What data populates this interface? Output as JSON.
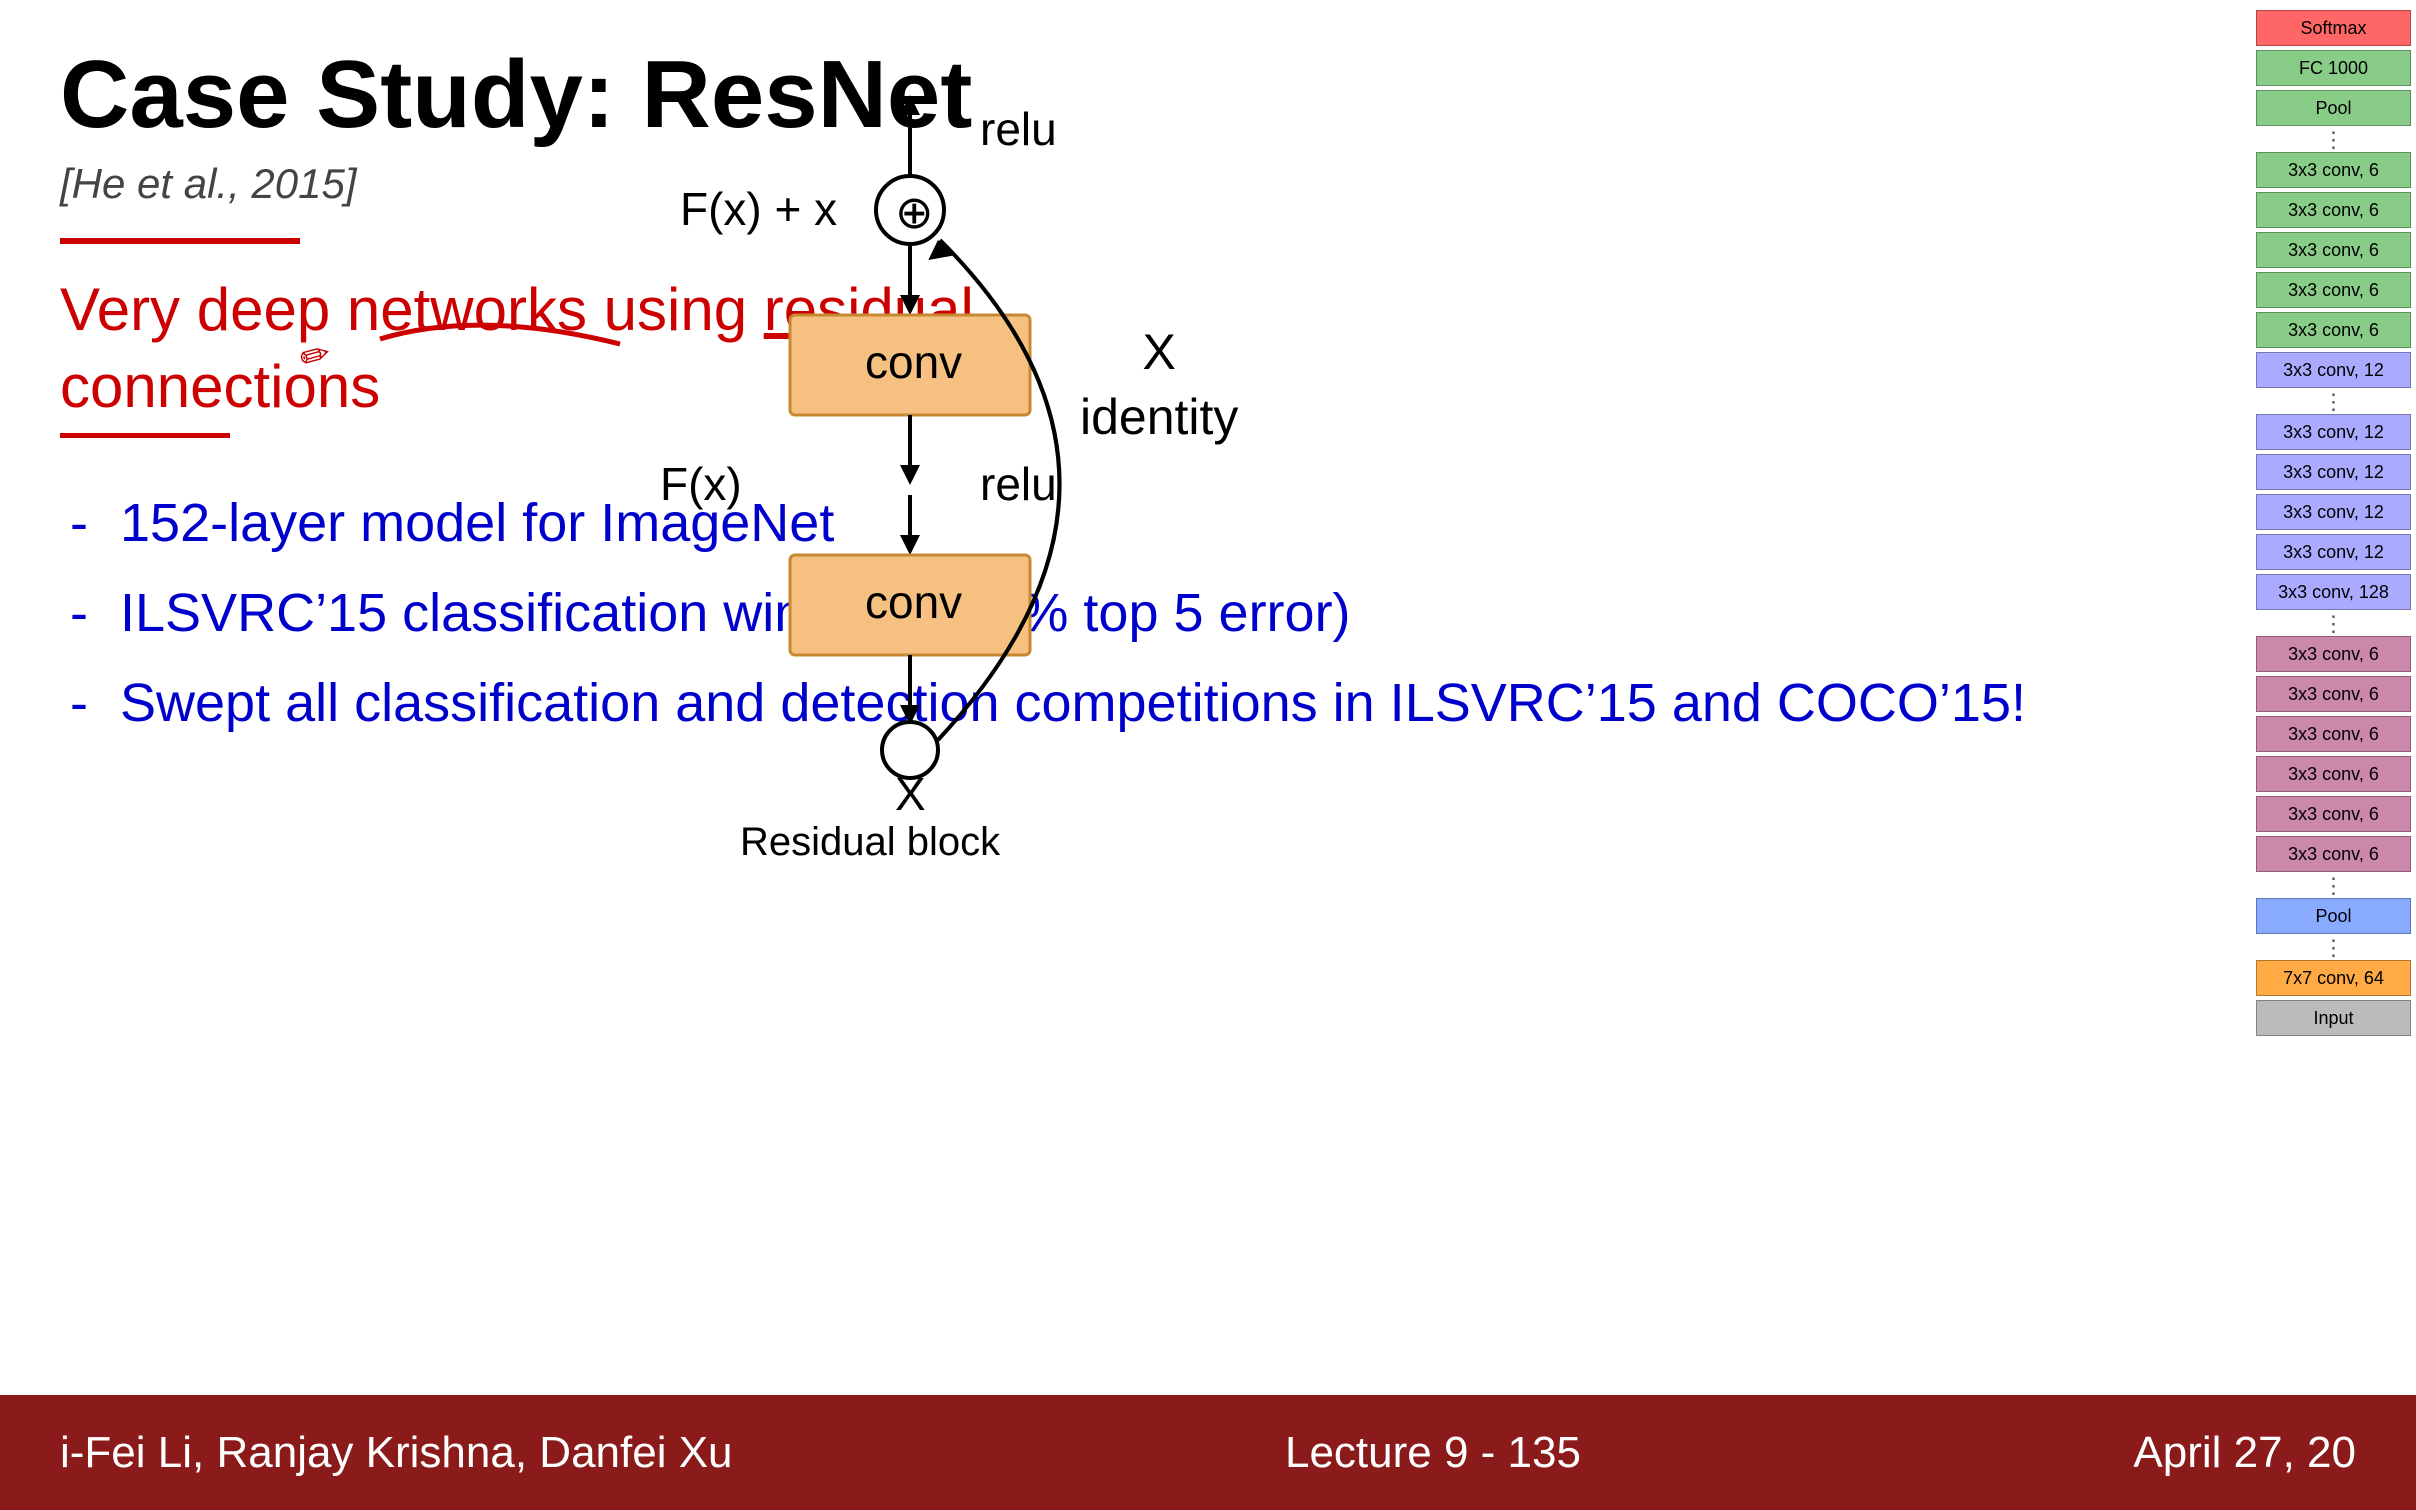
{
  "slide": {
    "title": "Case Study: ResNet",
    "subtitle": "[He et al., 2015]",
    "description_line1": "Very deep networks using residual",
    "description_line2": "connections",
    "bullet1": "152-layer model for ImageNet",
    "bullet2": "ILSVRC’15 classification winner (3.57% top 5 error)",
    "bullet3": "Swept all classification and detection competitions in ILSVRC’15 and COCO’15!",
    "diagram": {
      "relu_top": "relu",
      "fx_plus_x": "F(x) + x",
      "conv_top": "conv",
      "relu_mid": "relu",
      "conv_bottom": "conv",
      "fx_label": "F(x)",
      "x_label": "X",
      "residual_block_label": "Residual block",
      "x_identity": "X",
      "identity": "identity"
    },
    "sidebar_layers": [
      {
        "label": "Softmax",
        "color": "#ff6666"
      },
      {
        "label": "FC 1000",
        "color": "#88cc88"
      },
      {
        "label": "Pool",
        "color": "#88cc88"
      },
      {
        "label": "3x3 conv, 6",
        "color": "#88cc88"
      },
      {
        "label": "3x3 conv, 6",
        "color": "#88cc88"
      },
      {
        "label": "3x3 conv, 6",
        "color": "#88cc88"
      },
      {
        "label": "3x3 conv, 6",
        "color": "#88cc88"
      },
      {
        "label": "3x3 conv, 6",
        "color": "#88cc88"
      },
      {
        "label": "3x3 conv, 12",
        "color": "#aaaaff"
      },
      {
        "label": "3x3 conv, 12",
        "color": "#aaaaff"
      },
      {
        "label": "3x3 conv, 12",
        "color": "#aaaaff"
      },
      {
        "label": "3x3 conv, 12",
        "color": "#aaaaff"
      },
      {
        "label": "3x3 conv, 12",
        "color": "#aaaaff"
      },
      {
        "label": "3x3 conv, 128",
        "color": "#aaaaff"
      },
      {
        "label": "3x3 conv, 6",
        "color": "#cc88aa"
      },
      {
        "label": "3x3 conv, 6",
        "color": "#cc88aa"
      },
      {
        "label": "3x3 conv, 6",
        "color": "#cc88aa"
      },
      {
        "label": "3x3 conv, 6",
        "color": "#cc88aa"
      },
      {
        "label": "3x3 conv, 6",
        "color": "#cc88aa"
      },
      {
        "label": "3x3 conv, 6",
        "color": "#cc88aa"
      },
      {
        "label": "Pool",
        "color": "#88aaff"
      },
      {
        "label": "7x7 conv, 64",
        "color": "#ffaa44"
      },
      {
        "label": "Input",
        "color": "#bbbbbb"
      }
    ]
  },
  "footer": {
    "author": "i-Fei Li, Ranjay Krishna, Danfei Xu",
    "lecture": "Lecture 9 -  135",
    "date": "April 27, 20"
  }
}
